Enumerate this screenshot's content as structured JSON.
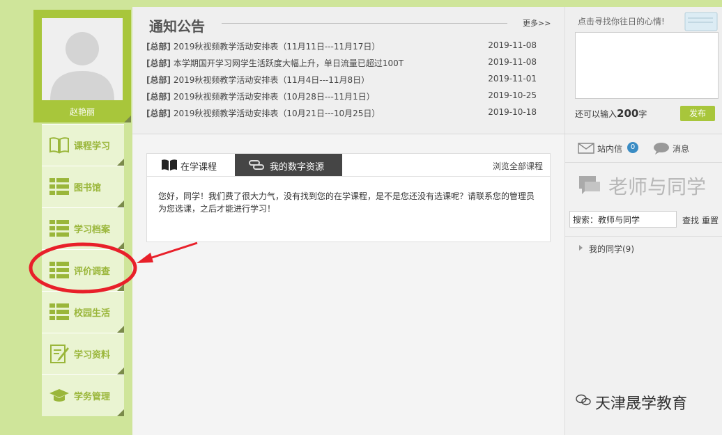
{
  "user": {
    "name": "赵艳丽"
  },
  "nav": {
    "items": [
      {
        "label": "课程学习",
        "icon": "book-icon"
      },
      {
        "label": "图书馆",
        "icon": "list-icon"
      },
      {
        "label": "学习档案",
        "icon": "list-icon"
      },
      {
        "label": "评价调查",
        "icon": "list-icon"
      },
      {
        "label": "校园生活",
        "icon": "list-icon"
      },
      {
        "label": "学习资料",
        "icon": "edit-icon"
      },
      {
        "label": "学务管理",
        "icon": "graduation-cap-icon"
      }
    ]
  },
  "notice": {
    "title": "通知公告",
    "more": "更多>>",
    "items": [
      {
        "tag": "[总部]",
        "text": "2019秋视频教学活动安排表（11月11日---11月17日）",
        "date": "2019-11-08"
      },
      {
        "tag": "[总部]",
        "text": "本学期国开学习网学生活跃度大幅上升，单日流量已超过100T",
        "date": "2019-11-08"
      },
      {
        "tag": "[总部]",
        "text": "2019秋视频教学活动安排表（11月4日---11月8日）",
        "date": "2019-11-01"
      },
      {
        "tag": "[总部]",
        "text": "2019秋视频教学活动安排表（10月28日---11月1日）",
        "date": "2019-10-25"
      },
      {
        "tag": "[总部]",
        "text": "2019秋视频教学活动安排表（10月21日---10月25日）",
        "date": "2019-10-18"
      }
    ]
  },
  "mood": {
    "hint": "点击寻找你往日的心情!",
    "count_prefix": "还可以输入",
    "count_value": "200",
    "count_suffix": "字",
    "publish": "发布"
  },
  "course": {
    "tab_current": "在学课程",
    "tab_digital": "我的数字资源",
    "browse_all": "浏览全部课程",
    "message": "您好，同学！我们费了很大力气，没有找到您的在学课程，是不是您还没有选课呢？请联系您的管理员为您选课，之后才能进行学习！"
  },
  "right": {
    "mail_label": "站内信",
    "mail_count": "0",
    "msg_label": "消息",
    "section_title": "老师与同学",
    "search_value": "搜索：教师与同学",
    "find": "查找",
    "reset": "重置",
    "classmates": "我的同学(9)"
  },
  "watermark": {
    "text": "天津晟学教育"
  },
  "colors": {
    "accent": "#a8c63b",
    "sidebar_bg": "#cfe59a",
    "nav_bg": "#eaf4d2",
    "annotation": "#e8202a"
  }
}
